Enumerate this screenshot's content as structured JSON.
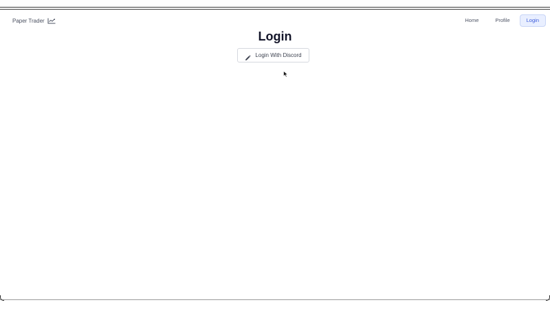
{
  "header": {
    "brand": "Paper Trader",
    "brand_icon": "chart-icon",
    "nav": [
      {
        "label": "Home"
      },
      {
        "label": "Profile"
      },
      {
        "label": "Login",
        "active": true
      }
    ]
  },
  "main": {
    "title": "Login",
    "discord_button": {
      "label": "Login With Discord",
      "icon": "pencil-icon"
    }
  },
  "colors": {
    "accent": "#3b5bdb",
    "accent_bg": "#e9efff",
    "text_primary": "#14162a",
    "text_muted": "#4f5566"
  }
}
